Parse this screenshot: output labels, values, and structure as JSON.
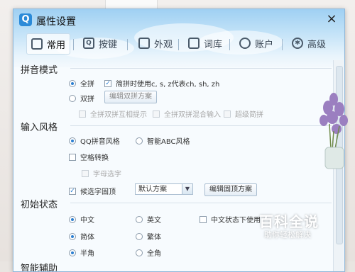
{
  "window": {
    "title": "属性设置",
    "logo": "Q",
    "close": "×"
  },
  "tabs": [
    {
      "label": "常用",
      "icon": "monitor-icon"
    },
    {
      "label": "按键",
      "icon": "keyboard-key-icon"
    },
    {
      "label": "外观",
      "icon": "tshirt-icon"
    },
    {
      "label": "词库",
      "icon": "book-icon"
    },
    {
      "label": "账户",
      "icon": "user-icon"
    },
    {
      "label": "高级",
      "icon": "gear-icon"
    }
  ],
  "pinyin": {
    "title": "拼音模式",
    "full": "全拼",
    "full_check": "简拼时使用c, s, z代表ch, sh, zh",
    "double": "双拼",
    "edit_double": "编辑双拼方案",
    "d1": "全拼双拼互相提示",
    "d2": "全拼双拼混合输入",
    "d3": "超级简拼"
  },
  "style": {
    "title": "输入风格",
    "qq": "QQ拼音风格",
    "abc": "智能ABC风格",
    "space": "空格转换",
    "letter": "字母选字",
    "candidate": "候选字固顶",
    "scheme_value": "默认方案",
    "edit_fixed": "编辑固顶方案"
  },
  "init": {
    "title": "初始状态",
    "cn": "中文",
    "en": "英文",
    "cn_state": "中文状态下使用",
    "simp": "简体",
    "trad": "繁体",
    "half": "半角",
    "full": "全角"
  },
  "next_section": "智能辅助",
  "watermark": {
    "line1": "百科全说",
    "line2": "助你轻松解决"
  },
  "colors": {
    "accent": "#2c7fd1",
    "border": "#8fb7d9"
  }
}
